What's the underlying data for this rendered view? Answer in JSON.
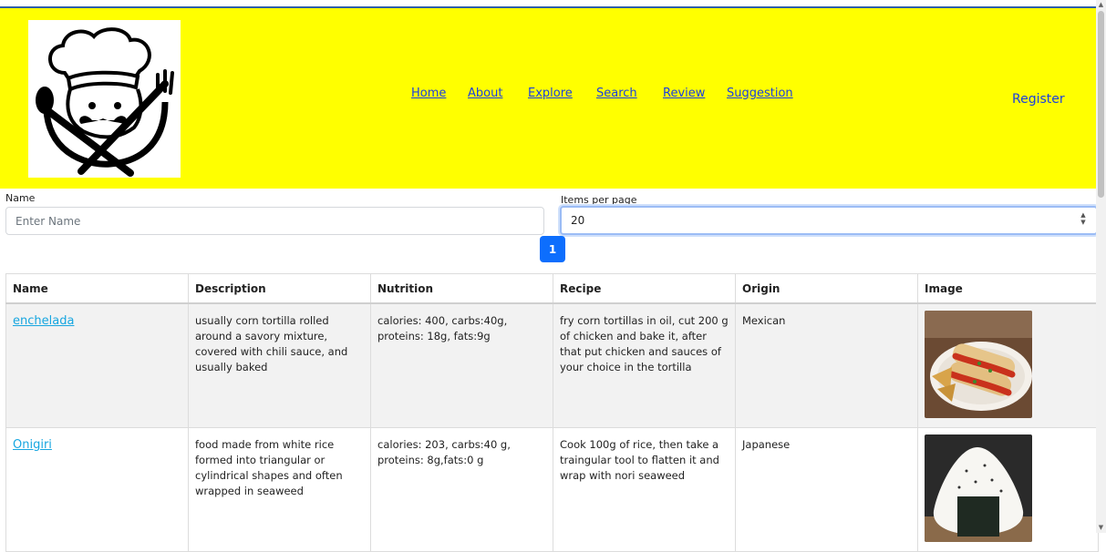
{
  "header": {
    "bg_color": "#ffff00",
    "logo_icon": "chef-logo-icon",
    "nav": [
      {
        "label": "Home"
      },
      {
        "label": "About"
      },
      {
        "label": "Explore"
      },
      {
        "label": "Search"
      },
      {
        "label": "Review"
      },
      {
        "label": "Suggestion"
      }
    ],
    "register_label": "Register",
    "link_color": "#1a3fe0"
  },
  "filters": {
    "name_label": "Name",
    "name_placeholder": "Enter Name",
    "name_value": "",
    "items_label": "Items per page",
    "items_value": "20"
  },
  "pagination": {
    "current_page": "1",
    "color": "#0d6efd"
  },
  "table": {
    "columns": [
      "Name",
      "Description",
      "Nutrition",
      "Recipe",
      "Origin",
      "Image"
    ],
    "rows": [
      {
        "name": "enchelada",
        "description": "usually corn tortilla rolled around a savory mixture, covered with chili sauce, and usually baked",
        "nutrition": "calories: 400, carbs:40g, proteins: 18g, fats:9g",
        "recipe": "fry corn tortillas in oil, cut 200 g of chicken and bake it, after that put chicken and sauces of your choice in the tortilla",
        "origin": "Mexican",
        "image_icon": "enchilada-photo"
      },
      {
        "name": "Onigiri",
        "description": "food made from white rice formed into triangular or cylindrical shapes and often wrapped in seaweed",
        "nutrition": "calories: 203, carbs:40 g, proteins: 8g,fats:0 g",
        "recipe": "Cook 100g of rice, then take a traingular tool to flatten it and wrap with nori seaweed",
        "origin": "Japanese",
        "image_icon": "onigiri-photo"
      }
    ]
  }
}
